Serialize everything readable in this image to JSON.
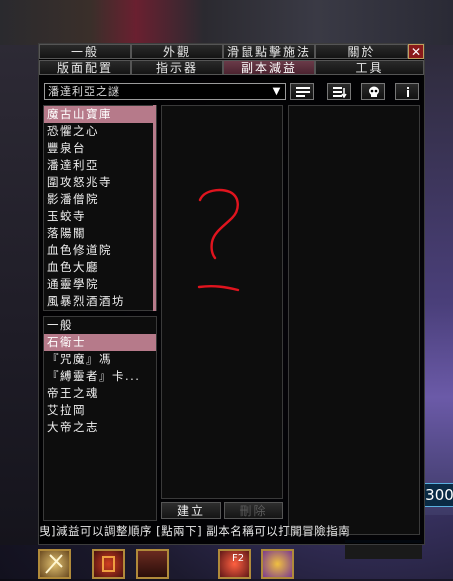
{
  "tabs": {
    "row1": [
      {
        "label": "一般"
      },
      {
        "label": "外觀"
      },
      {
        "label": "滑鼠點擊施法"
      },
      {
        "label": "關於"
      }
    ],
    "row2": [
      {
        "label": "版面配置"
      },
      {
        "label": "指示器"
      },
      {
        "label": "副本減益",
        "active": true
      },
      {
        "label": "工具"
      }
    ],
    "close": "✕"
  },
  "toolbar": {
    "dropdown_value": "潘達利亞之謎",
    "dropdown_arrow": "▼"
  },
  "instances": [
    {
      "label": "魔古山寶庫",
      "selected": true
    },
    {
      "label": "恐懼之心"
    },
    {
      "label": "豐泉台"
    },
    {
      "label": "潘達利亞"
    },
    {
      "label": "圍攻怒兆寺"
    },
    {
      "label": "影潘僧院"
    },
    {
      "label": "玉蛟寺"
    },
    {
      "label": "落陽關"
    },
    {
      "label": "血色修道院"
    },
    {
      "label": "血色大廳"
    },
    {
      "label": "通靈學院"
    },
    {
      "label": "風暴烈酒酒坊"
    }
  ],
  "bosses": [
    {
      "label": "一般"
    },
    {
      "label": "石衛士",
      "selected": true
    },
    {
      "label": "『咒魔』馮"
    },
    {
      "label": "『縛靈者』卡..."
    },
    {
      "label": "帝王之魂"
    },
    {
      "label": "艾拉岡"
    },
    {
      "label": "大帝之志"
    }
  ],
  "buttons": {
    "create": "建立",
    "delete": "刪除"
  },
  "hint": "曳]減益可以調整順序 [點兩下] 副本名稱可以打開冒險指南",
  "annotation": {
    "color": "#e0141e"
  },
  "game": {
    "counter": "300",
    "keybind": "F2"
  }
}
